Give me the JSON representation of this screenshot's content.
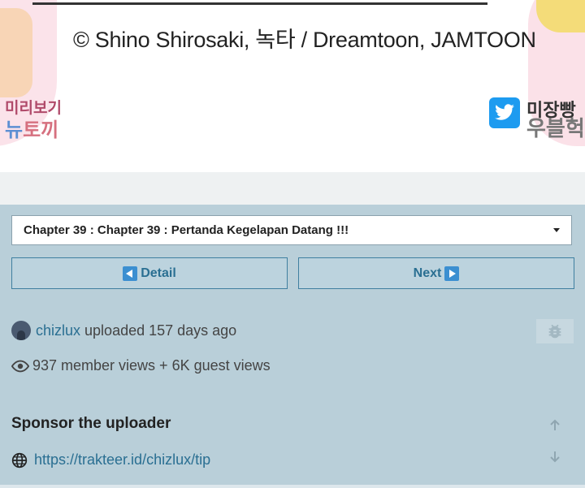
{
  "comic": {
    "credit": "© Shino Shirosaki, 녹타 / Dreamtoon, JAMTOON",
    "left_text_a": "미리보기",
    "left_text_b_part1": "뉴",
    "left_text_b_part2": "토끼",
    "right_text_a": "미장빵",
    "right_text_b": "우블헉"
  },
  "chapter_select": {
    "selected": "Chapter 39 : Chapter 39 : Pertanda Kegelapan Datang !!!"
  },
  "nav": {
    "detail_label": "Detail",
    "next_label": "Next"
  },
  "uploader": {
    "username": "chizlux",
    "action_text": "uploaded 157 days ago"
  },
  "stats": {
    "views_text": "937 member views + 6K guest views"
  },
  "sponsor": {
    "title": "Sponsor the uploader",
    "link": "https://trakteer.id/chizlux/tip"
  },
  "colors": {
    "panel_bg": "#b9cfd9",
    "link": "#2a6f92",
    "button_border": "#3f7fa0"
  }
}
